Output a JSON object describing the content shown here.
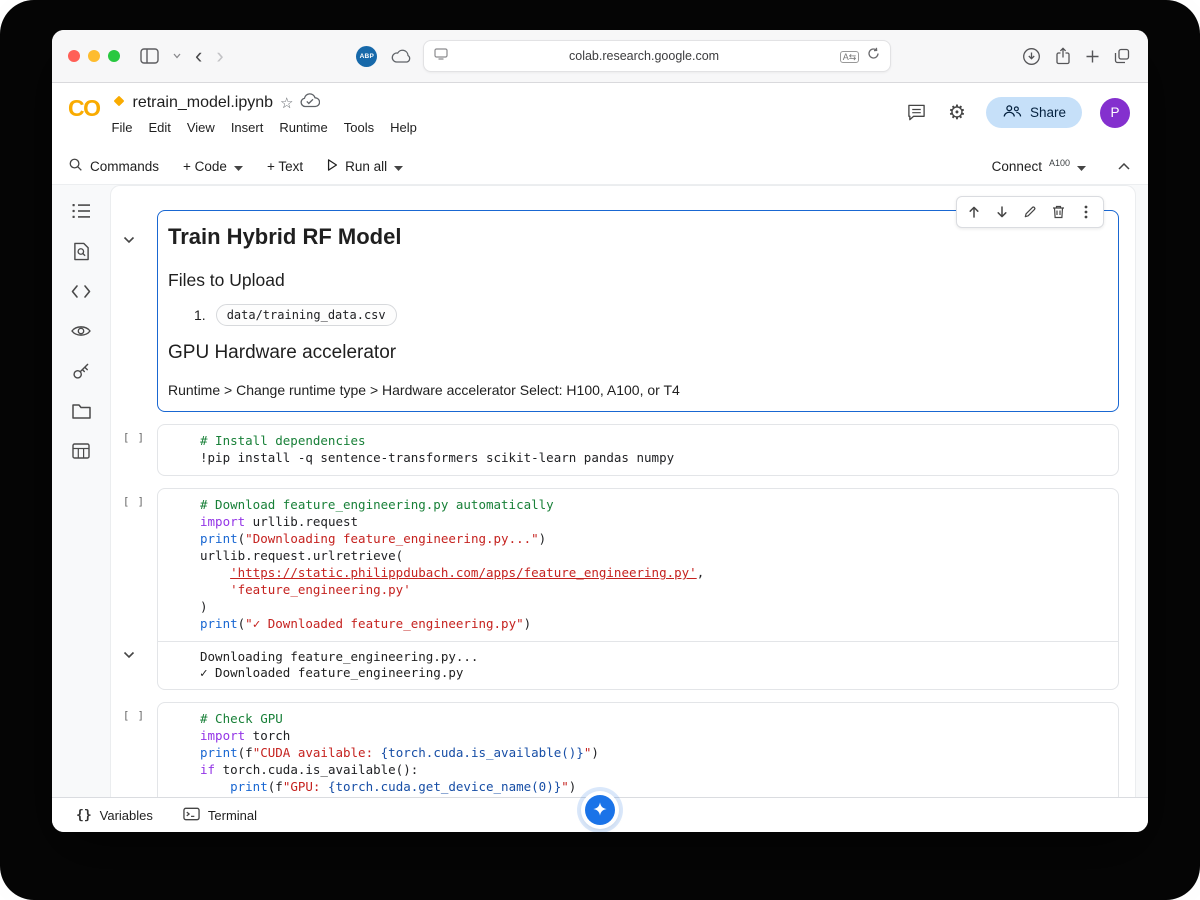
{
  "colors": {
    "accent_blue": "#1a73e8",
    "selected_cell_border": "#1967d2",
    "colab_orange": "#f9ab00",
    "share_pill_bg": "#c6e0f9",
    "avatar_purple": "#8430ce",
    "comment_green": "#188038",
    "keyword_purple": "#9334e6",
    "string_red": "#c5221f"
  },
  "browser": {
    "url": "colab.research.google.com",
    "abp_badge": "ABP"
  },
  "header": {
    "logo_text": "CO",
    "notebook_title": "retrain_model.ipynb",
    "menus": [
      "File",
      "Edit",
      "View",
      "Insert",
      "Runtime",
      "Tools",
      "Help"
    ],
    "share_label": "Share",
    "avatar_letter": "P"
  },
  "toolbar": {
    "commands_label": "Commands",
    "add_code_label": "+ Code",
    "add_text_label": "+ Text",
    "run_all_label": "Run all",
    "connect_label": "Connect",
    "accelerator_label": "A100"
  },
  "markdown_cell": {
    "heading": "Train Hybrid RF Model",
    "files_heading": "Files to Upload",
    "list_marker": "1.",
    "file_chip": "data/training_data.csv",
    "gpu_heading": "GPU Hardware accelerator",
    "runtime_instructions": "Runtime > Change runtime type > Hardware accelerator Select: H100, A100, or T4"
  },
  "code_cells": [
    {
      "gutter": "[ ]",
      "lines": [
        [
          [
            "cm",
            "# Install dependencies"
          ]
        ],
        [
          [
            "pl",
            "!pip install -q sentence-transformers scikit-learn pandas numpy"
          ]
        ]
      ],
      "output": []
    },
    {
      "gutter": "[ ]",
      "lines": [
        [
          [
            "cm",
            "# Download feature_engineering.py automatically"
          ]
        ],
        [
          [
            "kw",
            "import"
          ],
          [
            "pl",
            " urllib.request"
          ]
        ],
        [
          [
            "fn",
            "print"
          ],
          [
            "pl",
            "("
          ],
          [
            "str",
            "\"Downloading feature_engineering.py...\""
          ],
          [
            "pl",
            ")"
          ]
        ],
        [
          [
            "pl",
            "urllib.request.urlretrieve("
          ]
        ],
        [
          [
            "pl",
            "    "
          ],
          [
            "lnk",
            "'https://static.philippdubach.com/apps/feature_engineering.py'"
          ],
          [
            "pl",
            ","
          ]
        ],
        [
          [
            "pl",
            "    "
          ],
          [
            "str",
            "'feature_engineering.py'"
          ]
        ],
        [
          [
            "pl",
            ")"
          ]
        ],
        [
          [
            "fn",
            "print"
          ],
          [
            "pl",
            "("
          ],
          [
            "str",
            "\"✓ Downloaded feature_engineering.py\""
          ],
          [
            "pl",
            ")"
          ]
        ]
      ],
      "output": [
        "Downloading feature_engineering.py...",
        "✓ Downloaded feature_engineering.py"
      ]
    },
    {
      "gutter": "[ ]",
      "lines": [
        [
          [
            "cm",
            "# Check GPU"
          ]
        ],
        [
          [
            "kw",
            "import"
          ],
          [
            "pl",
            " torch"
          ]
        ],
        [
          [
            "fn",
            "print"
          ],
          [
            "pl",
            "(f"
          ],
          [
            "str",
            "\"CUDA available: "
          ],
          [
            "ip",
            "{torch.cuda.is_available()}"
          ],
          [
            "str",
            "\""
          ],
          [
            "pl",
            ")"
          ]
        ],
        [
          [
            "kw",
            "if"
          ],
          [
            "pl",
            " torch.cuda.is_available():"
          ]
        ],
        [
          [
            "pl",
            "    "
          ],
          [
            "fn",
            "print"
          ],
          [
            "pl",
            "(f"
          ],
          [
            "str",
            "\"GPU: "
          ],
          [
            "ip",
            "{torch.cuda.get_device_name(0)}"
          ],
          [
            "str",
            "\""
          ],
          [
            "pl",
            ")"
          ]
        ]
      ],
      "output": []
    }
  ],
  "statusbar": {
    "variables_icon": "{}",
    "variables_label": "Variables",
    "terminal_label": "Terminal"
  }
}
